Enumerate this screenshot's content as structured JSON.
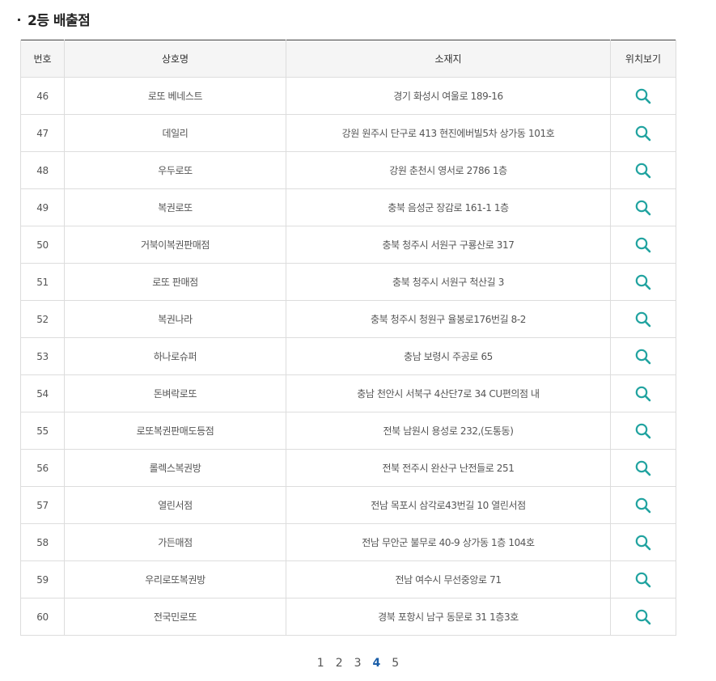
{
  "section": {
    "title": "2등 배출점"
  },
  "table": {
    "headers": [
      "번호",
      "상호명",
      "소재지",
      "위치보기"
    ],
    "rows": [
      {
        "no": "46",
        "name": "로또 베네스트",
        "address": "경기 화성시 여울로 189-16"
      },
      {
        "no": "47",
        "name": "데일리",
        "address": "강원 원주시 단구로 413 현진에버빌5차 상가동 101호"
      },
      {
        "no": "48",
        "name": "우두로또",
        "address": "강원 춘천시 영서로 2786 1층"
      },
      {
        "no": "49",
        "name": "복권로또",
        "address": "충북 음성군 장감로 161-1 1층"
      },
      {
        "no": "50",
        "name": "거북이복권판매점",
        "address": "충북 청주시 서원구 구룡산로 317"
      },
      {
        "no": "51",
        "name": "로또 판매점",
        "address": "충북 청주시 서원구 척산길 3"
      },
      {
        "no": "52",
        "name": "복권나라",
        "address": "충북 청주시 청원구 율봉로176번길 8-2"
      },
      {
        "no": "53",
        "name": "하나로슈퍼",
        "address": "충남 보령시 주공로 65"
      },
      {
        "no": "54",
        "name": "돈벼락로또",
        "address": "충남 천안시 서북구 4산단7로 34 CU편의점 내"
      },
      {
        "no": "55",
        "name": "로또복권판매도등점",
        "address": "전북 남원시 용성로 232,(도통동)"
      },
      {
        "no": "56",
        "name": "롤렉스복권방",
        "address": "전북 전주시 완산구 난전들로 251"
      },
      {
        "no": "57",
        "name": "열린서점",
        "address": "전남 목포시 삼각로43번길 10 열린서점"
      },
      {
        "no": "58",
        "name": "가든매점",
        "address": "전남 무안군 불무로 40-9 상가동 1층 104호"
      },
      {
        "no": "59",
        "name": "우리로또복권방",
        "address": "전남 여수시 무선중앙로 71"
      },
      {
        "no": "60",
        "name": "전국민로또",
        "address": "경북 포항시 남구 동문로 31 1층3호"
      }
    ]
  },
  "pagination": {
    "pages": [
      "1",
      "2",
      "3",
      "4",
      "5"
    ],
    "current": "4"
  },
  "colors": {
    "map_icon": "#21a3a0",
    "current_page": "#1a5ea8",
    "header_bg": "#f5f5f5",
    "border": "#dddddd"
  },
  "icons": {
    "map": "search-icon"
  }
}
